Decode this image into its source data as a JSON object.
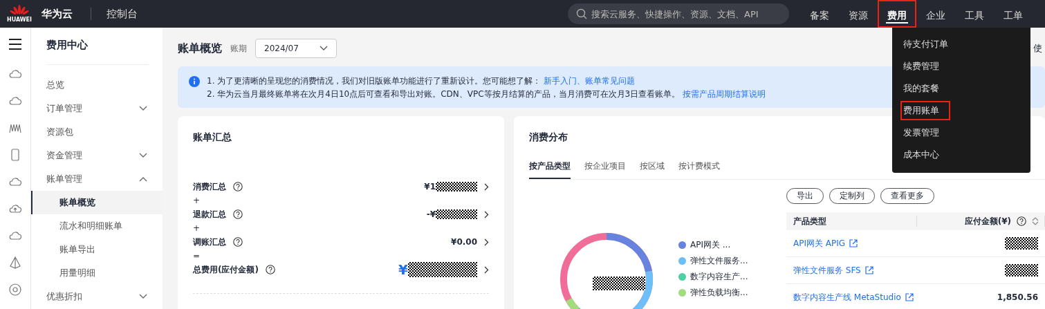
{
  "topbar": {
    "brand": "HUAWEI",
    "title": "华为云",
    "console": "控制台",
    "search": {
      "placeholder": "搜索云服务、快捷操作、资源、文档、API"
    },
    "nav": [
      {
        "label": "备案",
        "selected": false
      },
      {
        "label": "资源",
        "selected": false
      },
      {
        "label": "费用",
        "selected": true
      },
      {
        "label": "企业",
        "selected": false
      },
      {
        "label": "工具",
        "selected": false
      },
      {
        "label": "工单",
        "selected": false
      }
    ]
  },
  "dropdown": [
    {
      "label": "待支付订单",
      "selected": false
    },
    {
      "label": "续费管理",
      "selected": false
    },
    {
      "label": "我的套餐",
      "selected": false
    },
    {
      "label": "费用账单",
      "selected": true
    },
    {
      "label": "发票管理",
      "selected": false
    },
    {
      "label": "成本中心",
      "selected": false
    }
  ],
  "sidebar": {
    "title": "费用中心",
    "items": [
      {
        "label": "总览"
      },
      {
        "label": "订单管理",
        "expanded": false
      },
      {
        "label": "资源包"
      },
      {
        "label": "资金管理",
        "expanded": false
      },
      {
        "label": "账单管理",
        "expanded": true,
        "children": [
          {
            "label": "账单概览",
            "selected": true
          },
          {
            "label": "流水和明细账单",
            "selected": false
          },
          {
            "label": "账单导出",
            "selected": false
          },
          {
            "label": "用量明细",
            "selected": false
          }
        ]
      },
      {
        "label": "优惠折扣",
        "expanded": false
      }
    ]
  },
  "header": {
    "title": "账单概览",
    "period_label": "账期",
    "period": "2024/07",
    "right_text": "使"
  },
  "notice": {
    "lines": [
      {
        "text": "1. 为了更清晰的呈现您的消费情况，我们对旧版账单功能进行了重新设计。您可能想了解：",
        "link": "新手入门、账单常见问题"
      },
      {
        "text": "2. 华为云当月最终账单将在次月4日10点后可查看和导出对账。CDN、VPC等按月结算的产品，当月消费可在次月3日查看账单。",
        "link": "按需产品周期结算说明"
      }
    ]
  },
  "summary": {
    "title": "账单汇总",
    "rows": [
      {
        "label": "消费汇总",
        "amount": "¥1",
        "kind": "redacted",
        "op": "+"
      },
      {
        "label": "退款汇总",
        "amount": "-¥",
        "kind": "redacted",
        "op": "+"
      },
      {
        "label": "调账汇总",
        "amount": "¥0.00",
        "kind": "plain",
        "op": "="
      },
      {
        "label": "总费用(应付金额)",
        "amount": "¥",
        "kind": "total"
      }
    ]
  },
  "distribution": {
    "title": "消费分布",
    "tabs": [
      {
        "label": "按产品类型",
        "selected": true
      },
      {
        "label": "按企业项目",
        "selected": false
      },
      {
        "label": "按区域",
        "selected": false
      },
      {
        "label": "按计费模式",
        "selected": false
      }
    ],
    "legend": [
      {
        "label": "API网关 ...",
        "color": "#6683e0"
      },
      {
        "label": "弹性文件服务...",
        "color": "#6cbff8"
      },
      {
        "label": "数字内容生产...",
        "color": "#4fcfa6"
      },
      {
        "label": "弹性负载均衡...",
        "color": "#a3dc7e"
      }
    ],
    "buttons": [
      "导出",
      "定制列",
      "查看更多"
    ],
    "columns": [
      "产品类型",
      "应付金额(¥)"
    ],
    "rows": [
      {
        "product": "API网关 APIG",
        "amount": "",
        "kind": "redacted"
      },
      {
        "product": "弹性文件服务 SFS",
        "amount": "",
        "kind": "redacted"
      },
      {
        "product": "数字内容生产线 MetaStudio",
        "amount": "1,850.56",
        "kind": "plain"
      }
    ]
  }
}
